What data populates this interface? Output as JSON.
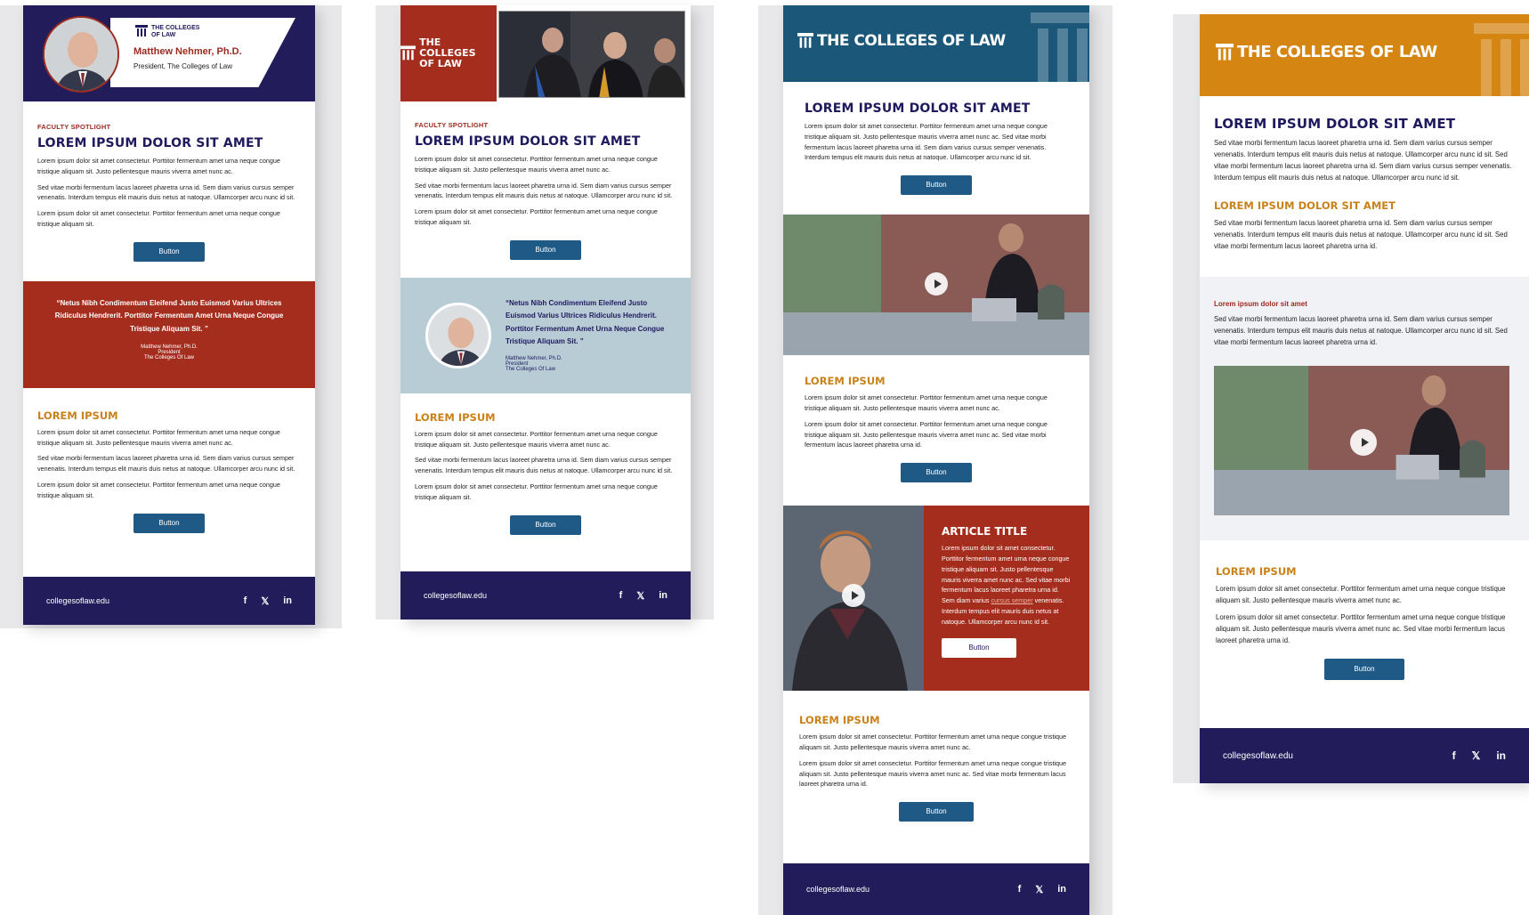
{
  "brand": {
    "logo_text": "THE COLLEGES OF LAW",
    "logo_line1": "THE COLLEGES",
    "logo_line2": "OF LAW"
  },
  "colors": {
    "navy": "#221d5a",
    "title_navy": "#1f1a5e",
    "red": "#9b2a1f",
    "gold": "#c9821a",
    "teal_blue": "#1f5a86",
    "header_blue": "#1b5779",
    "header_orange": "#d58512",
    "quote_blue": "#b8ccd6"
  },
  "email1": {
    "person_name": "Matthew Nehmer, Ph.D.",
    "person_role": "President, The Colleges of Law",
    "eyebrow": "FACULTY SPOTLIGHT",
    "title": "LOREM IPSUM DOLOR SIT AMET",
    "p1": "Lorem ipsum dolor sit amet consectetur. Porttitor fermentum amet urna neque congue tristique aliquam sit. Justo pellentesque mauris viverra amet nunc ac.",
    "p2": "Sed vitae morbi fermentum lacus laoreet pharetra urna id. Sem diam varius cursus semper venenatis. Interdum tempus elit mauris duis netus at natoque. Ullamcorper arcu nunc id sit.",
    "p3": "Lorem ipsum dolor sit amet consectetur. Porttitor fermentum amet urna neque congue tristique aliquam sit.",
    "button": "Button",
    "quote": "“Netus Nibh Condimentum Eleifend Justo Euismod Varius Ultrices Ridiculus Hendrerit. Porttitor Fermentum Amet Urna Neque Congue Tristique Aliquam Sit. ”",
    "quote_name": "Matthew Nehmer, Ph.D.",
    "quote_role": "President",
    "quote_org": "The Colleges Of Law",
    "h2": "LOREM IPSUM",
    "p4": "Lorem ipsum dolor sit amet consectetur. Porttitor fermentum amet urna neque congue tristique aliquam sit. Justo pellentesque mauris viverra amet nunc ac.",
    "p5": "Sed vitae morbi fermentum lacus laoreet pharetra urna id. Sem diam varius cursus semper venenatis. Interdum tempus elit mauris duis netus at natoque. Ullamcorper arcu nunc id sit.",
    "p6": "Lorem ipsum dolor sit amet consectetur. Porttitor fermentum amet urna neque congue tristique aliquam sit.",
    "button2": "Button",
    "footer_url": "collegesoflaw.edu"
  },
  "email2": {
    "eyebrow": "FACULTY SPOTLIGHT",
    "title": "LOREM IPSUM DOLOR SIT AMET",
    "p1": "Lorem ipsum dolor sit amet consectetur. Porttitor fermentum amet urna neque congue tristique aliquam sit. Justo pellentesque mauris viverra amet nunc ac.",
    "p2": "Sed vitae morbi fermentum lacus laoreet pharetra urna id. Sem diam varius cursus semper venenatis. Interdum tempus elit mauris duis netus at natoque. Ullamcorper arcu nunc id sit.",
    "p3": "Lorem ipsum dolor sit amet consectetur. Porttitor fermentum amet urna neque congue tristique aliquam sit.",
    "button": "Button",
    "quote": "“Netus Nibh Condimentum Eleifend Justo Euismod Varius Ultrices Ridiculus Hendrerit. Porttitor Fermentum Amet Urna Neque Congue Tristique Aliquam Sit. ”",
    "quote_name": "Matthew Nehmer, Ph.D.",
    "quote_role": "President",
    "quote_org": "The Colleges Of Law",
    "h2": "LOREM IPSUM",
    "p4": "Lorem ipsum dolor sit amet consectetur. Porttitor fermentum amet urna neque congue tristique aliquam sit. Justo pellentesque mauris viverra amet nunc ac.",
    "p5": "Sed vitae morbi fermentum lacus laoreet pharetra urna id. Sem diam varius cursus semper venenatis. Interdum tempus elit mauris duis netus at natoque. Ullamcorper arcu nunc id sit.",
    "p6": "Lorem ipsum dolor sit amet consectetur. Porttitor fermentum amet urna neque congue tristique aliquam sit.",
    "button2": "Button",
    "footer_url": "collegesoflaw.edu"
  },
  "email3": {
    "title": "LOREM IPSUM DOLOR SIT AMET",
    "p1": "Lorem ipsum dolor sit amet consectetur. Porttitor fermentum amet urna neque congue tristique aliquam sit. Justo pellentesque mauris viverra amet nunc ac. Sed vitae morbi fermentum lacus laoreet pharetra urna id. Sem diam varius cursus semper venenatis. Interdum tempus elit mauris duis netus at natoque. Ullamcorper arcu nunc id sit.",
    "button": "Button",
    "h2": "LOREM IPSUM",
    "p2": "Lorem ipsum dolor sit amet consectetur. Porttitor fermentum amet urna neque congue tristique aliquam sit. Justo pellentesque mauris viverra amet nunc ac.",
    "p3": "Lorem ipsum dolor sit amet consectetur. Porttitor fermentum amet urna neque congue tristique aliquam sit. Justo pellentesque mauris viverra amet nunc ac. Sed vitae morbi fermentum lacus laoreet pharetra urna id.",
    "button2": "Button",
    "article_title": "ARTICLE TITLE",
    "article_p_a": "Lorem ipsum dolor sit amet consectetur. Porttitor fermentum amet urna neque congue tristique aliquam sit. Justo pellentesque mauris viverra amet nunc ac. Sed vitae morbi fermentum lacus laoreet pharetra urna id. Sem diam varius ",
    "article_link": "cursus semper",
    "article_p_b": " venenatis. Interdum tempus elit mauris duis netus at natoque. Ullamcorper arcu nunc id sit.",
    "article_button": "Button",
    "h2b": "LOREM IPSUM",
    "p4": "Lorem ipsum dolor sit amet consectetur. Porttitor fermentum amet urna neque congue tristique aliquam sit. Justo pellentesque mauris viverra amet nunc ac.",
    "p5": "Lorem ipsum dolor sit amet consectetur. Porttitor fermentum amet urna neque congue tristique aliquam sit. Justo pellentesque mauris viverra amet nunc ac. Sed vitae morbi fermentum lacus laoreet pharetra urna id.",
    "button3": "Button",
    "footer_url": "collegesoflaw.edu"
  },
  "email4": {
    "title": "LOREM IPSUM DOLOR SIT AMET",
    "p1": "Sed vitae morbi fermentum lacus laoreet pharetra urna id. Sem diam varius cursus semper venenatis. Interdum tempus elit mauris duis netus at natoque. Ullamcorper arcu nunc id sit. Sed vitae morbi fermentum lacus laoreet pharetra urna id. Sem diam varius cursus semper venenatis. Interdum tempus elit mauris duis netus at natoque. Ullamcorper arcu nunc id sit.",
    "subtitle": "LOREM IPSUM DOLOR SIT AMET",
    "p2": "Sed vitae morbi fermentum lacus laoreet pharetra urna id. Sem diam varius cursus semper venenatis. Interdum tempus elit mauris duis netus at natoque. Ullamcorper arcu nunc id sit. Sed vitae morbi fermentum lacus laoreet pharetra urna id.",
    "eyebrow": "Lorem ipsum dolor sit amet",
    "p3": "Sed vitae morbi fermentum lacus laoreet pharetra urna id. Sem diam varius cursus semper venenatis. Interdum tempus elit mauris duis netus at natoque. Ullamcorper arcu nunc id sit. Sed vitae morbi fermentum lacus laoreet pharetra urna id.",
    "h2": "LOREM IPSUM",
    "p4": "Lorem ipsum dolor sit amet consectetur. Porttitor fermentum amet urna neque congue tristique aliquam sit. Justo pellentesque mauris viverra amet nunc ac.",
    "p5": "Lorem ipsum dolor sit amet consectetur. Porttitor fermentum amet urna neque congue tristique aliquam sit. Justo pellentesque mauris viverra amet nunc ac. Sed vitae morbi fermentum lacus laoreet pharetra urna id.",
    "button": "Button",
    "footer_url": "collegesoflaw.edu"
  },
  "social": {
    "facebook": "f",
    "x": "𝕏",
    "linkedin": "in"
  },
  "icons": [
    "columns-logo-icon",
    "play-icon",
    "facebook-icon",
    "x-icon",
    "linkedin-icon"
  ]
}
